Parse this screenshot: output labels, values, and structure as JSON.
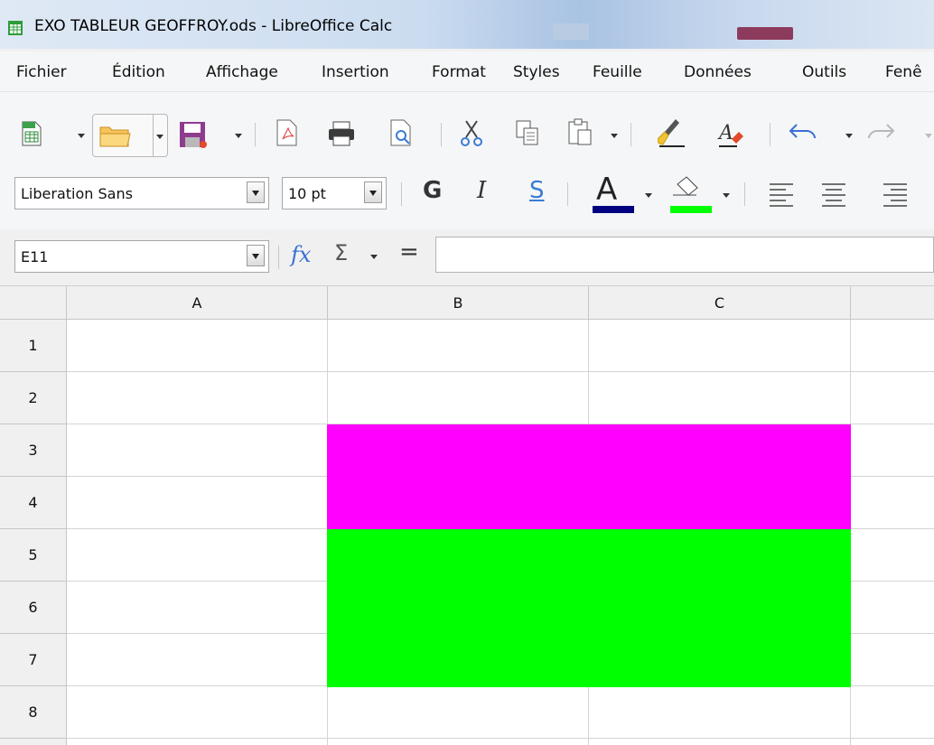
{
  "window": {
    "title": "EXO TABLEUR GEOFFROY.ods - LibreOffice Calc"
  },
  "menu": [
    {
      "label": "Fichier"
    },
    {
      "label": "Édition"
    },
    {
      "label": "Affichage"
    },
    {
      "label": "Insertion"
    },
    {
      "label": "Format"
    },
    {
      "label": "Styles"
    },
    {
      "label": "Feuille"
    },
    {
      "label": "Données"
    },
    {
      "label": "Outils"
    },
    {
      "label": "Fenê"
    }
  ],
  "toolbar": {
    "icons": [
      "new-spreadsheet-icon",
      "open-folder-icon",
      "save-icon",
      "export-pdf-icon",
      "print-icon",
      "print-preview-icon",
      "cut-icon",
      "copy-icon",
      "paste-icon",
      "clone-formatting-icon",
      "clear-formatting-icon",
      "undo-icon",
      "redo-icon"
    ]
  },
  "format_toolbar": {
    "font_name": "Liberation Sans",
    "font_size": "10 pt",
    "bold_label": "G",
    "italic_label": "I",
    "underline_label": "S",
    "font_color_label": "A",
    "font_color": "#000080",
    "highlight_color": "#00ff00"
  },
  "formula_bar": {
    "name_box": "E11",
    "function_label": "fx",
    "sum_label": "Σ",
    "equals_label": "=",
    "content": ""
  },
  "sheet": {
    "columns": [
      "A",
      "B",
      "C"
    ],
    "rows": [
      "1",
      "2",
      "3",
      "4",
      "5",
      "6",
      "7",
      "8"
    ],
    "fills": [
      {
        "range": "B3:C4",
        "color": "#ff00ff"
      },
      {
        "range": "B5:C7",
        "color": "#00ff00"
      }
    ]
  }
}
